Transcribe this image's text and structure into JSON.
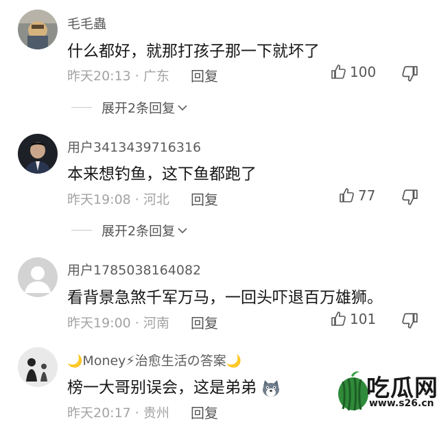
{
  "comments": [
    {
      "username": "毛毛蟲",
      "text": "什么都好，就那打孩子那一下就坏了",
      "time": "昨天20:13",
      "location": "广东",
      "likes": "100",
      "expand_label": "展开2条回复"
    },
    {
      "username": "用户3413439716316",
      "text": "本来想钓鱼，这下鱼都跑了",
      "time": "昨天19:08",
      "location": "河北",
      "likes": "77",
      "expand_label": "展开2条回复"
    },
    {
      "username": "用户1785038164082",
      "text": "看背景急煞千军万马，一回头吓退百万雄狮。",
      "time": "昨天19:00",
      "location": "河南",
      "likes": "101"
    },
    {
      "username_prefix": "🌙",
      "username": "Money⚡治愈生活の答案",
      "username_suffix": "🌙",
      "text": "榜一大哥别误会，这是弟弟",
      "time": "昨天20:17",
      "location": "贵州"
    }
  ],
  "common": {
    "separator": " · ",
    "reply_label": "回复"
  },
  "watermark": {
    "brand": "吃瓜网",
    "url": "www.s26.cn"
  }
}
